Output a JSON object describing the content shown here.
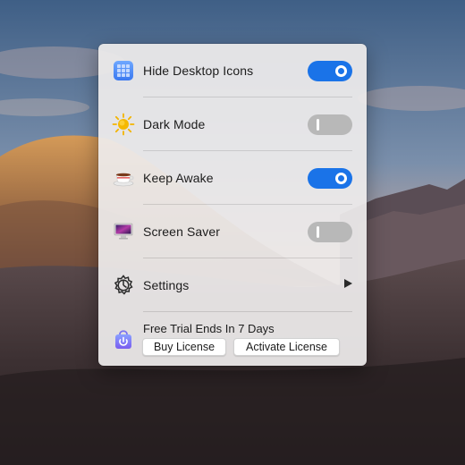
{
  "colors": {
    "accent": "#1a73e8",
    "toggle_off": "#b8b8b8",
    "panel_bg": "#eeecec"
  },
  "menu": {
    "items": [
      {
        "label": "Hide Desktop Icons",
        "icon": "grid-icon",
        "toggle": true
      },
      {
        "label": "Dark Mode",
        "icon": "sun-icon",
        "toggle": false
      },
      {
        "label": "Keep Awake",
        "icon": "coffee-cup-icon",
        "toggle": true
      },
      {
        "label": "Screen Saver",
        "icon": "monitor-icon",
        "toggle": false
      },
      {
        "label": "Settings",
        "icon": "gear-icon",
        "submenu": true
      }
    ],
    "trial": {
      "text": "Free Trial Ends In 7 Days",
      "icon": "shopping-bag-icon",
      "buy_label": "Buy License",
      "activate_label": "Activate License"
    }
  }
}
